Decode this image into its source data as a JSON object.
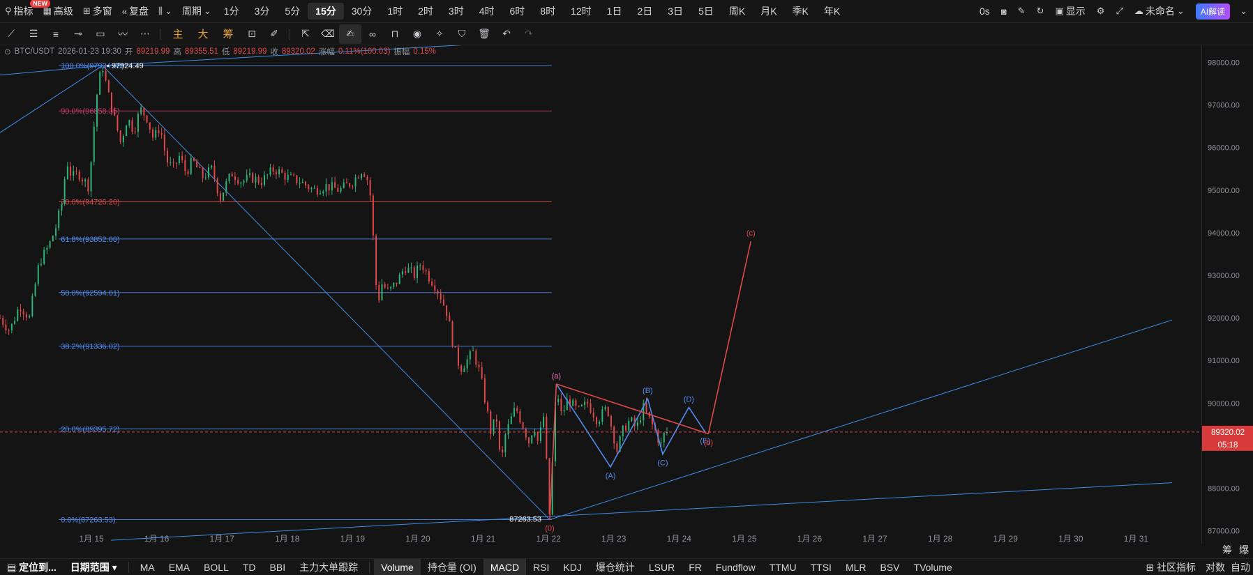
{
  "toolbar": {
    "indicators": "指标",
    "new_badge": "NEW",
    "advanced": "高级",
    "multi_window": "多窗",
    "replay": "复盘",
    "period_label": "周期",
    "periods": [
      "1分",
      "3分",
      "5分",
      "15分",
      "30分",
      "1时",
      "2时",
      "3时",
      "4时",
      "6时",
      "8时",
      "12时",
      "1日",
      "2日",
      "3日",
      "5日",
      "周K",
      "月K",
      "季K",
      "年K"
    ],
    "active_period": "15分",
    "countdown": "0s",
    "display": "显示",
    "layout_name": "未命名",
    "ai_button": "AI解读"
  },
  "drawing_tools": {
    "chip_labels": [
      "主",
      "大",
      "筹"
    ]
  },
  "info_bar": {
    "symbol": "BTC/USDT",
    "datetime": "2026-01-23 19:30",
    "open_label": "开",
    "open": "89219.99",
    "high_label": "高",
    "high": "89355.51",
    "low_label": "低",
    "low": "89219.99",
    "close_label": "收",
    "close": "89320.02",
    "change_label": "涨幅",
    "change": "0.11%(100.03)",
    "amp_label": "振幅",
    "amp": "0.15%"
  },
  "chart_data": {
    "type": "candlestick",
    "symbol": "BTC/USDT",
    "interval": "15分",
    "ylim": [
      86700,
      98400
    ],
    "y_ticks": [
      87000,
      88000,
      89000,
      90000,
      91000,
      92000,
      93000,
      94000,
      95000,
      96000,
      97000,
      98000
    ],
    "y_tick_labels": [
      "87000.00",
      "88000.00",
      "89000.00",
      "90000.00",
      "91000.00",
      "92000.00",
      "93000.00",
      "94000.00",
      "95000.00",
      "96000.00",
      "97000.00",
      "98000.00"
    ],
    "x_ticks": [
      "1月 15",
      "1月 16",
      "1月 17",
      "1月 18",
      "1月 19",
      "1月 20",
      "1月 21",
      "1月 22",
      "1月 23",
      "1月 24",
      "1月 25",
      "1月 26",
      "1月 27",
      "1月 28",
      "1月 29",
      "1月 30",
      "1月 31"
    ],
    "x_ticks_day": [
      15,
      16,
      17,
      18,
      19,
      20,
      21,
      22,
      23,
      24,
      25,
      26,
      27,
      28,
      29,
      30,
      31
    ],
    "xlim_days": [
      13.6,
      32.0
    ],
    "price_path": [
      {
        "day": 13.6,
        "price": 92000
      },
      {
        "day": 13.75,
        "price": 91700
      },
      {
        "day": 13.9,
        "price": 92300
      },
      {
        "day": 14.05,
        "price": 92000
      },
      {
        "day": 14.2,
        "price": 93300
      },
      {
        "day": 14.35,
        "price": 93700
      },
      {
        "day": 14.45,
        "price": 94100
      },
      {
        "day": 14.55,
        "price": 94700
      },
      {
        "day": 14.62,
        "price": 95700
      },
      {
        "day": 14.7,
        "price": 95300
      },
      {
        "day": 14.8,
        "price": 95400
      },
      {
        "day": 14.95,
        "price": 95100
      },
      {
        "day": 15.02,
        "price": 96000
      },
      {
        "day": 15.06,
        "price": 97000
      },
      {
        "day": 15.12,
        "price": 97600
      },
      {
        "day": 15.17,
        "price": 97924
      },
      {
        "day": 15.25,
        "price": 97300
      },
      {
        "day": 15.35,
        "price": 96700
      },
      {
        "day": 15.45,
        "price": 96100
      },
      {
        "day": 15.55,
        "price": 96700
      },
      {
        "day": 15.65,
        "price": 96400
      },
      {
        "day": 15.75,
        "price": 96900
      },
      {
        "day": 15.85,
        "price": 96700
      },
      {
        "day": 15.95,
        "price": 96200
      },
      {
        "day": 16.05,
        "price": 96500
      },
      {
        "day": 16.15,
        "price": 95700
      },
      {
        "day": 16.25,
        "price": 95500
      },
      {
        "day": 16.35,
        "price": 95800
      },
      {
        "day": 16.45,
        "price": 95400
      },
      {
        "day": 16.55,
        "price": 95700
      },
      {
        "day": 16.7,
        "price": 95300
      },
      {
        "day": 16.85,
        "price": 95500
      },
      {
        "day": 16.97,
        "price": 94800
      },
      {
        "day": 17.05,
        "price": 95100
      },
      {
        "day": 17.15,
        "price": 95400
      },
      {
        "day": 17.3,
        "price": 95200
      },
      {
        "day": 17.45,
        "price": 95300
      },
      {
        "day": 17.6,
        "price": 95200
      },
      {
        "day": 17.8,
        "price": 95500
      },
      {
        "day": 18.0,
        "price": 95300
      },
      {
        "day": 18.2,
        "price": 95200
      },
      {
        "day": 18.4,
        "price": 95000
      },
      {
        "day": 18.6,
        "price": 95100
      },
      {
        "day": 18.8,
        "price": 95000
      },
      {
        "day": 19.0,
        "price": 95200
      },
      {
        "day": 19.15,
        "price": 95500
      },
      {
        "day": 19.22,
        "price": 95300
      },
      {
        "day": 19.28,
        "price": 94800
      },
      {
        "day": 19.33,
        "price": 93500
      },
      {
        "day": 19.38,
        "price": 92300
      },
      {
        "day": 19.45,
        "price": 92800
      },
      {
        "day": 19.55,
        "price": 92600
      },
      {
        "day": 19.7,
        "price": 92900
      },
      {
        "day": 19.8,
        "price": 93200
      },
      {
        "day": 19.95,
        "price": 93000
      },
      {
        "day": 20.05,
        "price": 93300
      },
      {
        "day": 20.15,
        "price": 93000
      },
      {
        "day": 20.25,
        "price": 92800
      },
      {
        "day": 20.35,
        "price": 92500
      },
      {
        "day": 20.45,
        "price": 92100
      },
      {
        "day": 20.55,
        "price": 91300
      },
      {
        "day": 20.65,
        "price": 90800
      },
      {
        "day": 20.75,
        "price": 91000
      },
      {
        "day": 20.85,
        "price": 91200
      },
      {
        "day": 20.95,
        "price": 90700
      },
      {
        "day": 21.05,
        "price": 89900
      },
      {
        "day": 21.12,
        "price": 89300
      },
      {
        "day": 21.2,
        "price": 89700
      },
      {
        "day": 21.27,
        "price": 88500
      },
      {
        "day": 21.33,
        "price": 89200
      },
      {
        "day": 21.42,
        "price": 89600
      },
      {
        "day": 21.5,
        "price": 89900
      },
      {
        "day": 21.6,
        "price": 89500
      },
      {
        "day": 21.7,
        "price": 89100
      },
      {
        "day": 21.78,
        "price": 89500
      },
      {
        "day": 21.85,
        "price": 89000
      },
      {
        "day": 21.92,
        "price": 89800
      },
      {
        "day": 21.97,
        "price": 88600
      },
      {
        "day": 22.02,
        "price": 87263
      },
      {
        "day": 22.06,
        "price": 88600
      },
      {
        "day": 22.12,
        "price": 90400
      },
      {
        "day": 22.2,
        "price": 89700
      },
      {
        "day": 22.3,
        "price": 90100
      },
      {
        "day": 22.45,
        "price": 89800
      },
      {
        "day": 22.6,
        "price": 90000
      },
      {
        "day": 22.75,
        "price": 89600
      },
      {
        "day": 22.9,
        "price": 89900
      },
      {
        "day": 22.97,
        "price": 89400
      },
      {
        "day": 23.05,
        "price": 88900
      },
      {
        "day": 23.15,
        "price": 89400
      },
      {
        "day": 23.25,
        "price": 89600
      },
      {
        "day": 23.35,
        "price": 89400
      },
      {
        "day": 23.45,
        "price": 89900
      },
      {
        "day": 23.55,
        "price": 89600
      },
      {
        "day": 23.65,
        "price": 89300
      },
      {
        "day": 23.72,
        "price": 89000
      },
      {
        "day": 23.78,
        "price": 89300
      },
      {
        "day": 23.82,
        "price": 89320
      }
    ],
    "last_price": 89320.02,
    "last_price_label": "89320.02",
    "countdown": "05:18",
    "high_marker": {
      "day": 15.17,
      "price": 97924.49,
      "label": "97924.49"
    },
    "low_marker": {
      "day": 22.02,
      "price": 87263.53,
      "label": "87263.53"
    },
    "fibonacci": {
      "start_day": 14.5,
      "end_day": 22.05,
      "levels": [
        {
          "label": "100.0%(97924.49)",
          "price": 97924.49,
          "color": "#4f8cf0"
        },
        {
          "label": "90.0%(96858.35)",
          "price": 96858.35,
          "color": "#c0396b"
        },
        {
          "label": "70.0%(94726.20)",
          "price": 94726.2,
          "color": "#e04848"
        },
        {
          "label": "61.8%(93852.00)",
          "price": 93852.0,
          "color": "#4f8cf0"
        },
        {
          "label": "50.0%(92594.01)",
          "price": 92594.01,
          "color": "#4f8cf0"
        },
        {
          "label": "38.2%(91336.02)",
          "price": 91336.02,
          "color": "#4f8cf0"
        },
        {
          "label": "20.0%(89395.72)",
          "price": 89395.72,
          "color": "#4f8cf0"
        },
        {
          "label": "0.0%(87263.53)",
          "price": 87263.53,
          "color": "#4f8cf0"
        }
      ]
    },
    "trendlines": [
      {
        "from": {
          "day": 13.6,
          "price": 97700
        },
        "to": {
          "day": 15.17,
          "price": 97924
        },
        "color": "#3a8ee6"
      },
      {
        "from": {
          "day": 13.6,
          "price": 96350
        },
        "to": {
          "day": 15.17,
          "price": 97924
        },
        "color": "#3a8ee6"
      },
      {
        "from": {
          "day": 15.17,
          "price": 97924
        },
        "to": {
          "day": 24.0,
          "price": 98700
        },
        "color": "#3a8ee6"
      },
      {
        "from": {
          "day": 15.17,
          "price": 97924
        },
        "to": {
          "day": 22.02,
          "price": 87263
        },
        "color": "#3a8ee6"
      },
      {
        "from": {
          "day": 22.02,
          "price": 87263
        },
        "to": {
          "day": 31.55,
          "price": 91950
        },
        "color": "#3a8ee6"
      },
      {
        "from": {
          "day": 15.3,
          "price": 86780
        },
        "to": {
          "day": 31.55,
          "price": 88130
        },
        "color": "#3a8ee6"
      }
    ],
    "wave_points": [
      {
        "label": "(0)",
        "day": 22.02,
        "price": 87263,
        "color": "#e04848",
        "pos": "below"
      },
      {
        "label": "(a)",
        "day": 22.12,
        "price": 90450,
        "color": "#e86bb5",
        "pos": "above"
      },
      {
        "label": "(A)",
        "day": 22.95,
        "price": 88500,
        "color": "#4f8cf0",
        "pos": "below"
      },
      {
        "label": "(B)",
        "day": 23.52,
        "price": 90100,
        "color": "#4f8cf0",
        "pos": "above"
      },
      {
        "label": "(C)",
        "day": 23.75,
        "price": 88800,
        "color": "#4f8cf0",
        "pos": "below"
      },
      {
        "label": "(D)",
        "day": 24.15,
        "price": 89900,
        "color": "#4f8cf0",
        "pos": "above"
      },
      {
        "label": "(E)",
        "day": 24.4,
        "price": 89320,
        "color": "#4f8cf0",
        "pos": "below"
      },
      {
        "label": "(b)",
        "day": 24.45,
        "price": 89280,
        "color": "#e04848",
        "pos": "below"
      },
      {
        "label": "(c)",
        "day": 25.1,
        "price": 93800,
        "color": "#e04848",
        "pos": "above"
      }
    ],
    "wave_lines": [
      {
        "points": [
          [
            22.12,
            90450
          ],
          [
            22.95,
            88500
          ],
          [
            23.52,
            90100
          ],
          [
            23.75,
            88800
          ],
          [
            24.15,
            89900
          ],
          [
            24.4,
            89320
          ]
        ],
        "color": "#4f8cf0"
      },
      {
        "points": [
          [
            22.02,
            87263
          ],
          [
            22.12,
            90450
          ]
        ],
        "color": "#e04848"
      },
      {
        "points": [
          [
            22.12,
            90450
          ],
          [
            24.45,
            89280
          ]
        ],
        "color": "#e04848"
      },
      {
        "points": [
          [
            24.45,
            89280
          ],
          [
            25.1,
            93800
          ]
        ],
        "color": "#e04848"
      }
    ]
  },
  "bottom_bar": {
    "locate": "定位到...",
    "date_range": "日期范围",
    "overlay_indicators": [
      "MA",
      "EMA",
      "BOLL",
      "TD",
      "BBI",
      "主力大单跟踪"
    ],
    "sub_indicators": [
      "Volume",
      "持仓量 (OI)",
      "MACD",
      "RSI",
      "KDJ",
      "爆仓统计",
      "LSUR",
      "FR",
      "Fundflow",
      "TTMU",
      "TTSI",
      "MLR",
      "BSV",
      "TVolume"
    ],
    "active_sub": [
      "Volume",
      "MACD"
    ],
    "community": "社区指标",
    "log_scale": "对数",
    "auto": "自动",
    "axis_btn_chip": "筹",
    "axis_btn_burst": "爆"
  }
}
